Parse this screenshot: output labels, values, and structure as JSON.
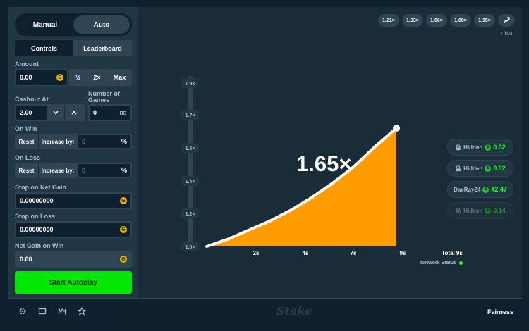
{
  "sidebar": {
    "mode": {
      "manual": "Manual",
      "auto": "Auto"
    },
    "tabs": {
      "controls": "Controls",
      "leaderboard": "Leaderboard"
    },
    "amount": {
      "label": "Amount",
      "value": "0.00",
      "half": "½",
      "double": "2×",
      "max": "Max"
    },
    "cashout": {
      "label": "Cashout At",
      "value": "2.00"
    },
    "games": {
      "label_line1": "Number of",
      "label_line2": "Games",
      "value": "0"
    },
    "on_win": {
      "label": "On Win",
      "reset": "Reset",
      "increase": "Increase by:",
      "value": "0",
      "unit": "%"
    },
    "on_loss": {
      "label": "On Loss",
      "reset": "Reset",
      "increase": "Increase by:",
      "value": "0",
      "unit": "%"
    },
    "stop_gain": {
      "label": "Stop on Net Gain",
      "value": "0.00000000"
    },
    "stop_loss": {
      "label": "Stop on Loss",
      "value": "0.00000000"
    },
    "net_gain": {
      "label": "Net Gain on Win",
      "value": "0.00"
    },
    "start_label": "Start Autoplay"
  },
  "history": [
    "1.21×",
    "1.33×",
    "1.66×",
    "1.00×",
    "1.15×"
  ],
  "you_label": "‹ You",
  "players": [
    {
      "name": "Hidden",
      "amount": "0.02",
      "hidden": true,
      "faded": false
    },
    {
      "name": "Hidden",
      "amount": "0.02",
      "hidden": true,
      "faded": false
    },
    {
      "name": "DaeRay24",
      "amount": "42.47",
      "hidden": false,
      "faded": false
    },
    {
      "name": "Hidden",
      "amount": "0.14",
      "hidden": true,
      "faded": true
    }
  ],
  "network_status": "Network Status",
  "fairness": "Fairness",
  "logo": "Stake",
  "chart_data": {
    "type": "area",
    "current_multiplier": "1.65×",
    "y_ticks": [
      "1.0×",
      "1.2×",
      "1.4×",
      "1.5×",
      "1.7×",
      "1.9×"
    ],
    "x_ticks": [
      "2s",
      "4s",
      "7s",
      "9s"
    ],
    "total_label": "Total 9s",
    "x": [
      0,
      1,
      2,
      3,
      4,
      5,
      6,
      7,
      8,
      9
    ],
    "y": [
      1.0,
      1.04,
      1.09,
      1.14,
      1.2,
      1.27,
      1.35,
      1.44,
      1.55,
      1.65
    ],
    "colors": {
      "fill": "#ff9d00",
      "line": "#ffffff"
    }
  }
}
